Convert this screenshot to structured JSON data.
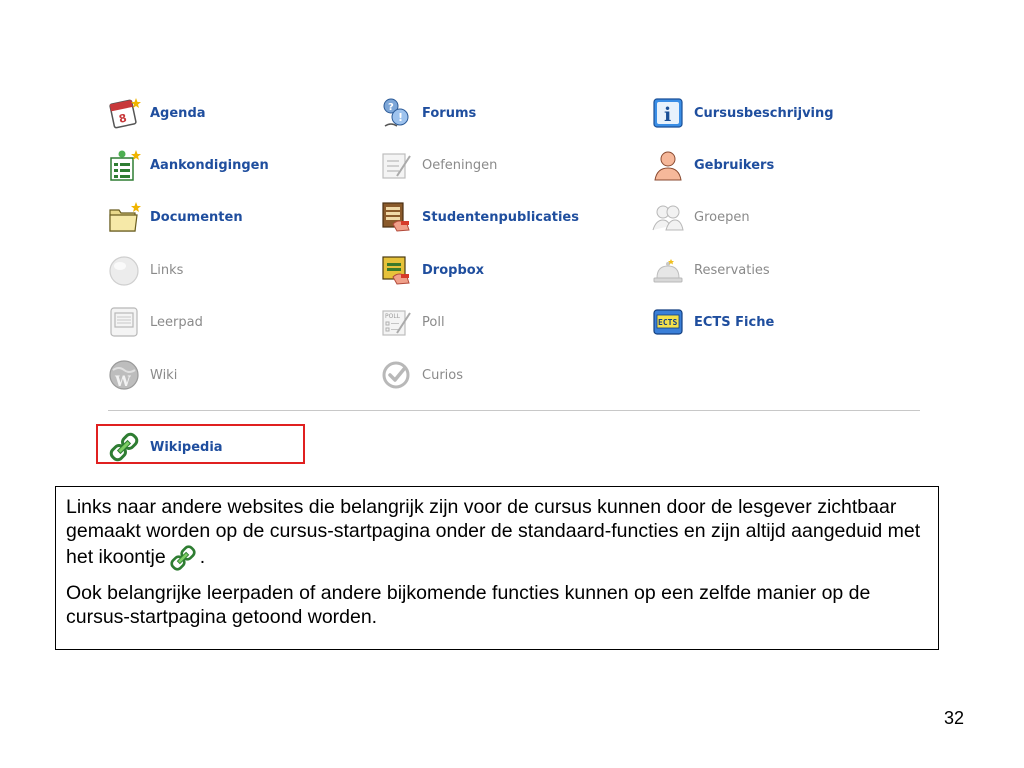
{
  "tools": {
    "agenda": "Agenda",
    "forums": "Forums",
    "cursusbeschrijving": "Cursusbeschrijving",
    "aankondigingen": "Aankondigingen",
    "oefeningen": "Oefeningen",
    "gebruikers": "Gebruikers",
    "documenten": "Documenten",
    "studentenpublicaties": "Studentenpublicaties",
    "groepen": "Groepen",
    "links": "Links",
    "dropbox": "Dropbox",
    "reservaties": "Reservaties",
    "leerpad": "Leerpad",
    "poll": "Poll",
    "ects_fiche": "ECTS Fiche",
    "wiki": "Wiki",
    "curios": "Curios"
  },
  "extra_tools": {
    "wikipedia": "Wikipedia"
  },
  "icons": {
    "agenda": "calendar-icon",
    "forums": "forum-people-icon",
    "cursusbeschrijving": "info-icon",
    "aankondigingen": "announcement-board-icon",
    "oefeningen": "exercise-checklist-icon",
    "gebruikers": "user-icon",
    "documenten": "folder-icon",
    "studentenpublicaties": "student-publication-icon",
    "groepen": "group-icon",
    "links": "globe-link-icon",
    "dropbox": "dropbox-hand-icon",
    "reservaties": "reservation-bell-icon",
    "leerpad": "learning-path-icon",
    "poll": "poll-icon",
    "ects_fiche": "ects-badge-icon",
    "wiki": "wiki-globe-icon",
    "curios": "curios-check-icon",
    "wikipedia": "external-link-chain-icon"
  },
  "note": {
    "paragraph1_before_icon": "Links naar andere websites die belangrijk zijn voor de cursus kunnen door de lesgever zichtbaar gemaakt worden op de cursus-startpagina onder de standaard-functies en zijn altijd aangeduid met het ikoontje",
    "paragraph1_after_icon": ".",
    "paragraph2": "Ook belangrijke leerpaden of andere bijkomende functies kunnen op een zelfde manier op de cursus-startpagina getoond worden."
  },
  "page_number": "32",
  "colors": {
    "active_label": "#1f4e9e",
    "inactive_label": "#8a8a8a",
    "highlight_border": "#e02020"
  }
}
